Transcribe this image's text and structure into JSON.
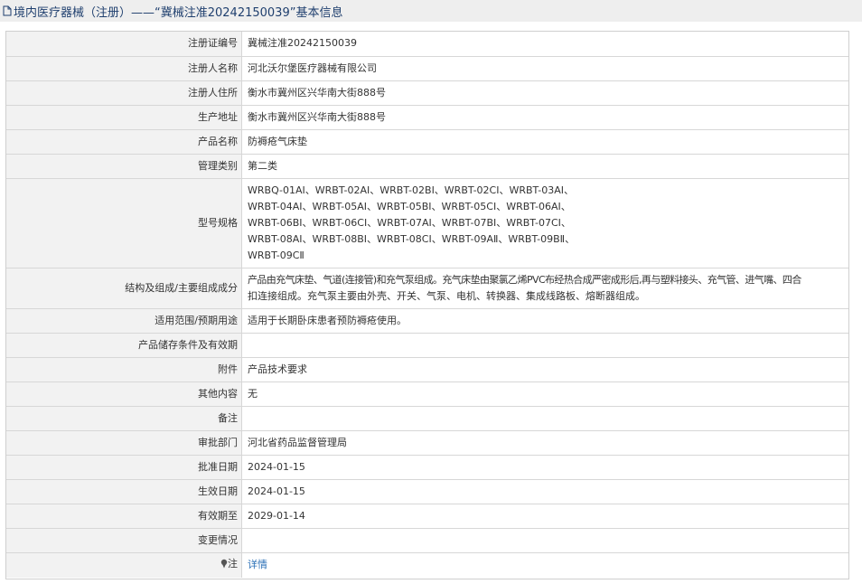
{
  "header": {
    "title": "境内医疗器械（注册）——“冀械注准20242150039”基本信息"
  },
  "rows": [
    {
      "label": "注册证编号",
      "value": "冀械注准20242150039"
    },
    {
      "label": "注册人名称",
      "value": "河北沃尔堡医疗器械有限公司"
    },
    {
      "label": "注册人住所",
      "value": "衡水市冀州区兴华南大街888号"
    },
    {
      "label": "生产地址",
      "value": "衡水市冀州区兴华南大街888号"
    },
    {
      "label": "产品名称",
      "value": "防褥疮气床垫"
    },
    {
      "label": "管理类别",
      "value": "第二类"
    },
    {
      "label": "型号规格",
      "lines": [
        "WRBQ-01AⅠ、WRBT-02AⅠ、WRBT-02BⅠ、WRBT-02CⅠ、WRBT-03AⅠ、",
        "WRBT-04AⅠ、WRBT-05AⅠ、WRBT-05BⅠ、WRBT-05CⅠ、WRBT-06AⅠ、",
        "WRBT-06BⅠ、WRBT-06CⅠ、WRBT-07AⅠ、WRBT-07BⅠ、WRBT-07CⅠ、",
        "WRBT-08AⅠ、WRBT-08BⅠ、WRBT-08CⅠ、WRBT-09AⅡ、WRBT-09BⅡ、",
        "WRBT-09CⅡ"
      ]
    },
    {
      "label": "结构及组成/主要组成成分",
      "lines": [
        "产品由充气床垫、气道(连接管)和充气泵组成。充气床垫由聚氯乙烯PVC布经热合成严密成形后,再与塑料接头、充气管、进气嘴、四合",
        "扣连接组成。充气泵主要由外壳、开关、气泵、电机、转换器、集成线路板、熔断器组成。"
      ]
    },
    {
      "label": "适用范围/预期用途",
      "value": "适用于长期卧床患者预防褥疮使用。"
    },
    {
      "label": "产品储存条件及有效期",
      "value": ""
    },
    {
      "label": "附件",
      "value": "产品技术要求"
    },
    {
      "label": "其他内容",
      "value": "无"
    },
    {
      "label": "备注",
      "value": ""
    },
    {
      "label": "审批部门",
      "value": "河北省药品监督管理局"
    },
    {
      "label": "批准日期",
      "value": "2024-01-15"
    },
    {
      "label": "生效日期",
      "value": "2024-01-15"
    },
    {
      "label": "有效期至",
      "value": "2029-01-14"
    },
    {
      "label": "变更情况",
      "value": ""
    },
    {
      "label": "注",
      "value": "详情",
      "link": true
    }
  ],
  "icons": {
    "title": "document-icon",
    "note": "pin-icon"
  },
  "colors": {
    "title_text": "#1f3f6e",
    "link": "#2a6fb6",
    "label_bg": "#f2f2f2"
  }
}
